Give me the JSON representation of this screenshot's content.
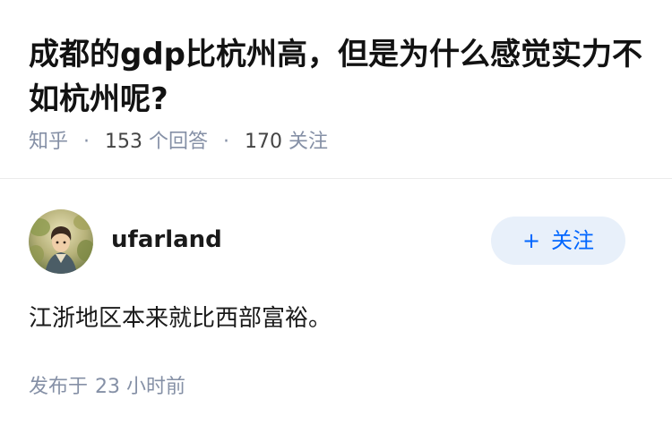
{
  "question": {
    "title": "成都的gdp比杭州高，但是为什么感觉实力不如杭州呢?",
    "source": "知乎",
    "separator": "·",
    "answer_count": "153",
    "answer_label": "个回答",
    "follower_count": "170",
    "follower_label": "关注"
  },
  "answer": {
    "author": "ufarland",
    "follow_label": "关注",
    "follow_icon": "plus-icon",
    "content": "江浙地区本来就比西部富裕。",
    "published_label": "发布于",
    "published_value": "23 小时前"
  },
  "colors": {
    "title": "#121212",
    "meta": "#8590a6",
    "accent": "#0066ff",
    "follow_bg": "#e8f0fa"
  }
}
